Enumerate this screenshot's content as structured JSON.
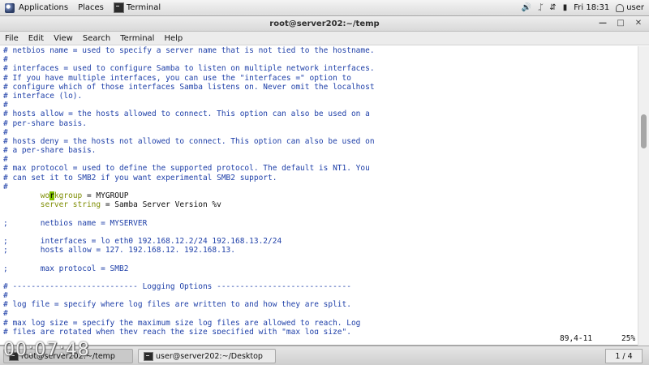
{
  "top_panel": {
    "applications": "Applications",
    "places": "Places",
    "terminal": "Terminal",
    "clock": "Fri 18:31",
    "user": "user",
    "icons": [
      "volume-icon",
      "bluetooth-icon",
      "network-icon",
      "power-icon"
    ]
  },
  "window": {
    "title": "root@server202:~/temp",
    "menu": [
      "File",
      "Edit",
      "View",
      "Search",
      "Terminal",
      "Help"
    ]
  },
  "terminal": {
    "lines": [
      {
        "t": "c",
        "text": "# netbios name = used to specify a server name that is not tied to the hostname."
      },
      {
        "t": "c",
        "text": "#"
      },
      {
        "t": "c",
        "text": "# interfaces = used to configure Samba to listen on multiple network interfaces."
      },
      {
        "t": "c",
        "text": "# If you have multiple interfaces, you can use the \"interfaces =\" option to"
      },
      {
        "t": "c",
        "text": "# configure which of those interfaces Samba listens on. Never omit the localhost"
      },
      {
        "t": "c",
        "text": "# interface (lo)."
      },
      {
        "t": "c",
        "text": "#"
      },
      {
        "t": "c",
        "text": "# hosts allow = the hosts allowed to connect. This option can also be used on a"
      },
      {
        "t": "c",
        "text": "# per-share basis."
      },
      {
        "t": "c",
        "text": "#"
      },
      {
        "t": "c",
        "text": "# hosts deny = the hosts not allowed to connect. This option can also be used on"
      },
      {
        "t": "c",
        "text": "# a per-share basis."
      },
      {
        "t": "c",
        "text": "#"
      },
      {
        "t": "c",
        "text": "# max protocol = used to define the supported protocol. The default is NT1. You"
      },
      {
        "t": "c",
        "text": "# can set it to SMB2 if you want experimental SMB2 support."
      },
      {
        "t": "c",
        "text": "#"
      },
      {
        "t": "cursor",
        "pre": "        wo",
        "cur": "r",
        "post": "kgroup",
        "value": " = MYGROUP"
      },
      {
        "t": "kv",
        "key": "        server string",
        "value": " = Samba Server Version %v"
      },
      {
        "t": "b",
        "text": ""
      },
      {
        "t": "o",
        "text": ";       netbios name = MYSERVER"
      },
      {
        "t": "b",
        "text": ""
      },
      {
        "t": "o",
        "text": ";       interfaces = lo eth0 192.168.12.2/24 192.168.13.2/24"
      },
      {
        "t": "o",
        "text": ";       hosts allow = 127. 192.168.12. 192.168.13."
      },
      {
        "t": "b",
        "text": ""
      },
      {
        "t": "o",
        "text": ";       max protocol = SMB2"
      },
      {
        "t": "b",
        "text": ""
      },
      {
        "t": "c",
        "text": "# --------------------------- Logging Options -----------------------------"
      },
      {
        "t": "c",
        "text": "#"
      },
      {
        "t": "c",
        "text": "# log file = specify where log files are written to and how they are split."
      },
      {
        "t": "c",
        "text": "#"
      },
      {
        "t": "c",
        "text": "# max log size = specify the maximum size log files are allowed to reach. Log"
      },
      {
        "t": "c",
        "text": "# files are rotated when they reach the size specified with \"max log size\"."
      }
    ],
    "status_position": "89,4-11",
    "status_percent": "25%",
    "scroll_position_fraction": 0.25
  },
  "taskbar": {
    "tasks": [
      "root@server202:~/temp",
      "user@server202:~/Desktop"
    ],
    "pager": "1 / 4"
  },
  "video_timer": "00:07:48"
}
